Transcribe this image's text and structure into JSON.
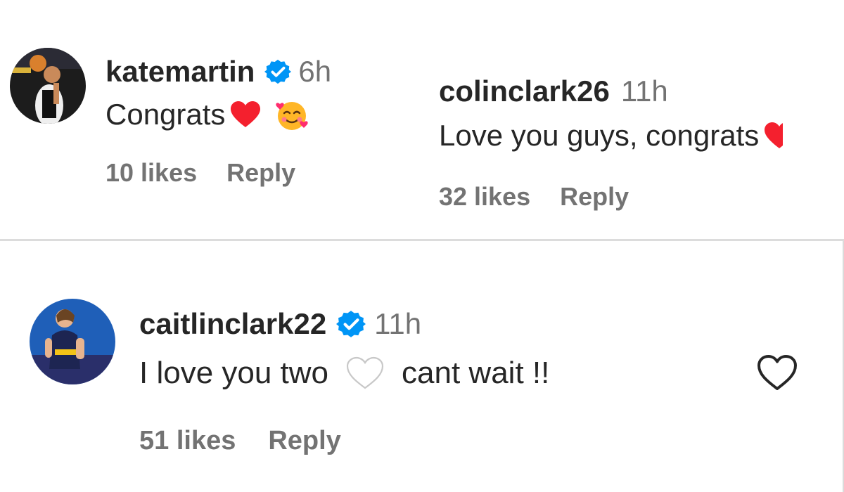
{
  "comments": [
    {
      "username": "katemartin",
      "verified": true,
      "time": "6h",
      "text": "Congrats",
      "likes": "10 likes",
      "reply": "Reply"
    },
    {
      "username": "colinclark26",
      "verified": false,
      "time": "11h",
      "text": "Love you guys, congrats",
      "likes": "32 likes",
      "reply": "Reply"
    },
    {
      "username": "caitlinclark22",
      "verified": true,
      "time": "11h",
      "text_before": "I love you two",
      "text_after": "cant wait !!",
      "likes": "51 likes",
      "reply": "Reply"
    }
  ],
  "colors": {
    "verified_blue": "#0095f6",
    "heart_red": "#ff2d3a",
    "muted_text": "#737373",
    "primary_text": "#262626"
  },
  "icons": [
    "verified-badge-icon",
    "red-heart-emoji-icon",
    "smiling-face-with-hearts-emoji-icon",
    "white-heart-emoji-icon",
    "like-heart-icon"
  ]
}
